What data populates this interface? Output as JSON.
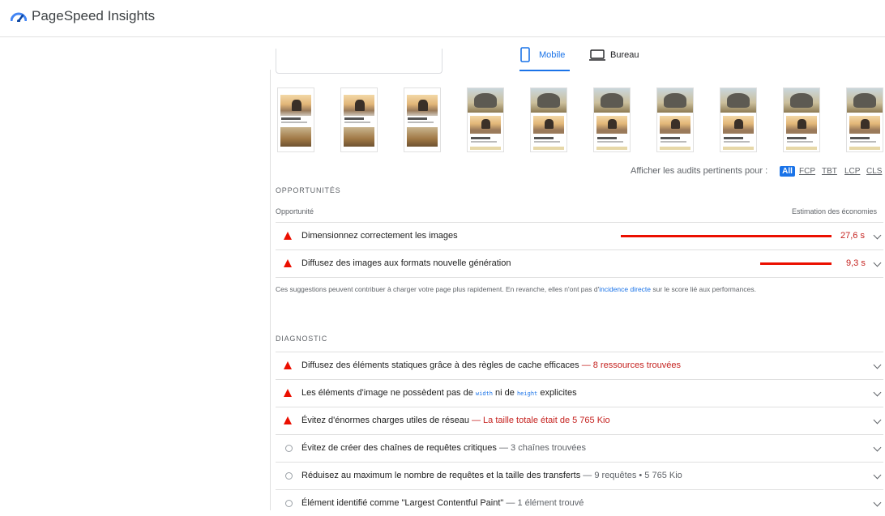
{
  "header": {
    "title": "PageSpeed Insights"
  },
  "tabs": {
    "mobile": "Mobile",
    "desktop": "Bureau"
  },
  "filmstrip": {
    "frames": 10
  },
  "filter": {
    "label": "Afficher les audits pertinents pour :",
    "all": "All",
    "fcp": "FCP",
    "tbt": "TBT",
    "lcp": "LCP",
    "cls": "CLS"
  },
  "opportunities": {
    "section_title": "OPPORTUNITÉS",
    "col_left": "Opportunité",
    "col_right": "Estimation des économies",
    "items": [
      {
        "title": "Dimensionnez correctement les images",
        "saving": "27,6 s",
        "saving_seconds": 27.6
      },
      {
        "title": "Diffusez des images aux formats nouvelle génération",
        "saving": "9,3 s",
        "saving_seconds": 9.3
      }
    ],
    "note_before": "Ces suggestions peuvent contribuer à charger votre page plus rapidement. En revanche, elles n'ont pas d'",
    "note_link": "incidence directe",
    "note_after": " sur le score lié aux performances."
  },
  "diagnostic": {
    "section_title": "DIAGNOSTIC",
    "items": [
      {
        "title": "Diffusez des éléments statiques grâce à des règles de cache efficaces",
        "detail": "— 8 ressources trouvées",
        "status": "fail"
      },
      {
        "title_before": "Les éléments d'image ne possèdent pas de ",
        "code1": "width",
        "title_mid": " ni de ",
        "code2": "height",
        "title_after": " explicites",
        "status": "fail"
      },
      {
        "title": "Évitez d'énormes charges utiles de réseau",
        "detail": "— La taille totale était de 5 765 Kio",
        "status": "fail"
      },
      {
        "title": "Évitez de créer des chaînes de requêtes critiques",
        "detail": "— 3 chaînes trouvées",
        "status": "info"
      },
      {
        "title": "Réduisez au maximum le nombre de requêtes et la taille des transferts",
        "detail": "— 9 requêtes • 5 765 Kio",
        "status": "info"
      },
      {
        "title": "Élément identifié comme \"Largest Contentful Paint\"",
        "detail": "— 1 élément trouvé",
        "status": "info"
      }
    ]
  },
  "colors": {
    "accent": "#1a73e8",
    "fail": "#eb0f00",
    "fail_text": "#c5221f",
    "muted": "#5f6368"
  },
  "icons": {
    "logo": "pagespeed-gauge-icon",
    "mobile": "phone-icon",
    "desktop": "laptop-icon",
    "fail": "warning-triangle-icon",
    "info": "circle-icon",
    "expand": "chevron-down-icon"
  }
}
